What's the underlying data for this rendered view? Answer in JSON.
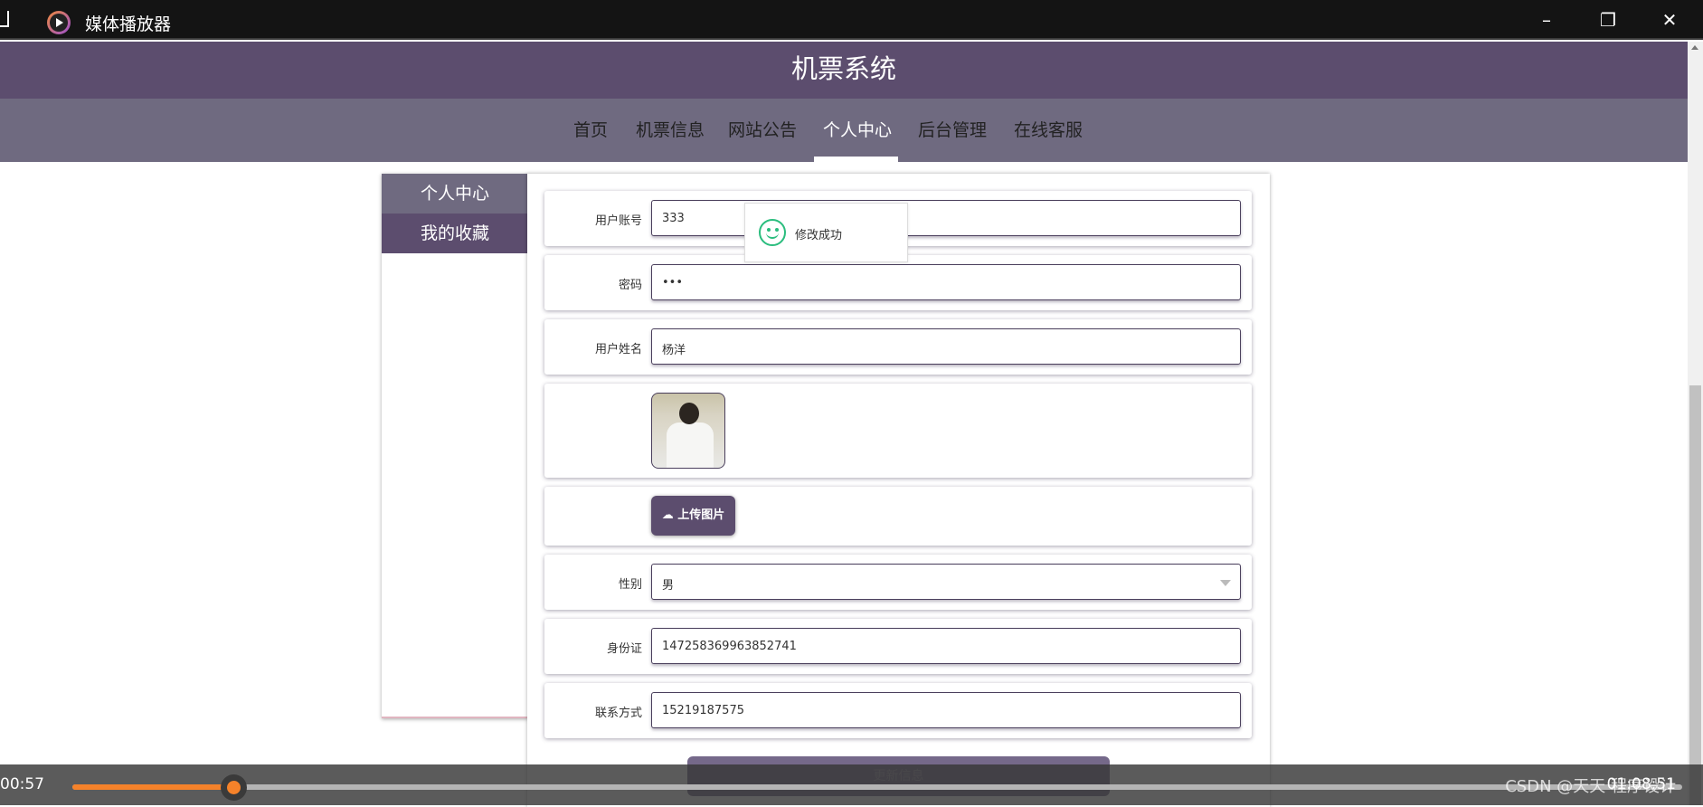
{
  "window": {
    "title": "媒体播放器",
    "min": "–",
    "max": "❐",
    "close": "✕"
  },
  "site": {
    "title": "机票系统"
  },
  "nav": [
    {
      "label": "首页"
    },
    {
      "label": "机票信息"
    },
    {
      "label": "网站公告"
    },
    {
      "label": "个人中心",
      "active": true
    },
    {
      "label": "后台管理"
    },
    {
      "label": "在线客服"
    }
  ],
  "sidebar": [
    {
      "label": "个人中心"
    },
    {
      "label": "我的收藏"
    }
  ],
  "form": {
    "account": {
      "label": "用户账号",
      "value": "333"
    },
    "password": {
      "label": "密码",
      "value": "•••"
    },
    "name": {
      "label": "用户姓名",
      "value": "杨洋"
    },
    "upload_label": "上传图片",
    "gender": {
      "label": "性别",
      "value": "男"
    },
    "idcard": {
      "label": "身份证",
      "value": "147258369963852741"
    },
    "phone": {
      "label": "联系方式",
      "value": "15219187575"
    },
    "submit": "更新信息"
  },
  "toast": {
    "message": "修改成功"
  },
  "player": {
    "current_time": "00:57",
    "duration": "01:08:51",
    "progress_percent": 10,
    "watermark": "CSDN @天天 程序设计"
  },
  "colors": {
    "header": "#5c4d6e",
    "nav": "#6f6a80",
    "accent": "#f5822a",
    "success": "#2bbd7e"
  }
}
